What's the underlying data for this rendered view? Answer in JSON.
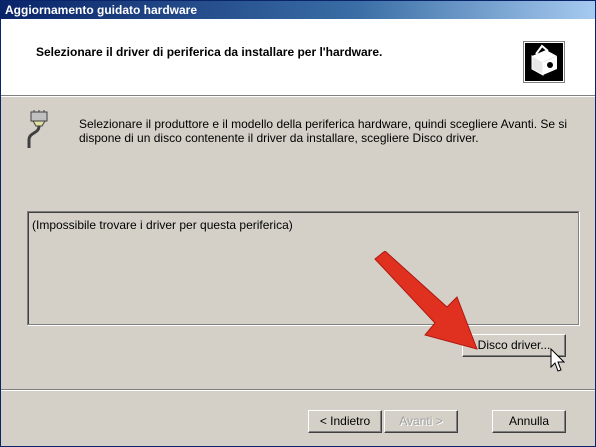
{
  "window": {
    "title": "Aggiornamento guidato hardware"
  },
  "header": {
    "title": "Selezionare il driver di periferica da installare per l'hardware."
  },
  "intro": {
    "text": "Selezionare il produttore e il modello della periferica hardware, quindi scegliere Avanti. Se si dispone di un disco contenente il driver da installare, scegliere Disco driver."
  },
  "listbox": {
    "message": "(Impossibile trovare i driver per questa periferica)"
  },
  "buttons": {
    "disk": "Disco driver...",
    "back": "< Indietro",
    "next": "Avanti >",
    "cancel": "Annulla"
  },
  "icons": {
    "header": "hardware-box-icon",
    "intro": "serial-cable-icon",
    "arrow": "red-arrow-icon",
    "cursor": "mouse-pointer-icon"
  },
  "colors": {
    "titlebar": "#0a246a",
    "arrow": "#e03020",
    "face": "#d4d0c8"
  }
}
